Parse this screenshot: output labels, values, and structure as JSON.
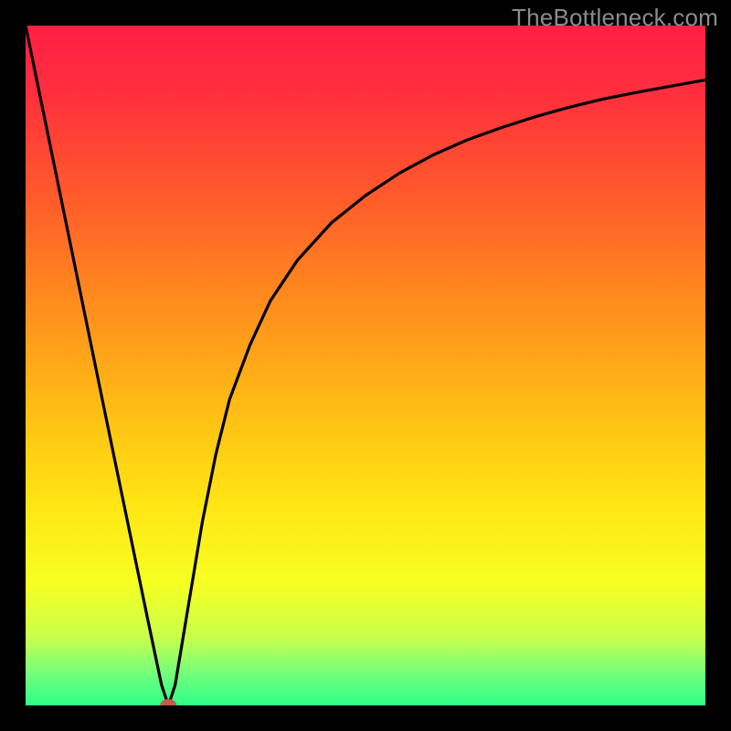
{
  "watermark": {
    "text": "TheBottleneck.com"
  },
  "gradient": {
    "stops": [
      {
        "offset": 0.0,
        "color": "#ff1f44"
      },
      {
        "offset": 0.1,
        "color": "#ff2f3d"
      },
      {
        "offset": 0.25,
        "color": "#ff5a2b"
      },
      {
        "offset": 0.4,
        "color": "#ff8a1e"
      },
      {
        "offset": 0.55,
        "color": "#ffb915"
      },
      {
        "offset": 0.7,
        "color": "#ffe413"
      },
      {
        "offset": 0.82,
        "color": "#f7ff22"
      },
      {
        "offset": 0.9,
        "color": "#c8ff4a"
      },
      {
        "offset": 0.95,
        "color": "#77ff7a"
      },
      {
        "offset": 1.0,
        "color": "#2fff88"
      }
    ]
  },
  "marker": {
    "color": "#c65a4a",
    "rx": 9,
    "ry": 7
  },
  "chart_data": {
    "type": "line",
    "title": "",
    "xlabel": "",
    "ylabel": "",
    "xlim": [
      0,
      100
    ],
    "ylim": [
      0,
      100
    ],
    "x": [
      0,
      4,
      8,
      12,
      15,
      18,
      20,
      21,
      22,
      24,
      26,
      28,
      30,
      33,
      36,
      40,
      45,
      50,
      55,
      60,
      65,
      70,
      75,
      80,
      85,
      90,
      95,
      100
    ],
    "values": [
      100,
      80.5,
      61,
      41.5,
      27,
      12.5,
      3,
      0,
      3,
      15,
      27,
      37,
      45,
      53,
      59.5,
      65.5,
      71,
      75,
      78.3,
      81,
      83.2,
      85,
      86.6,
      88,
      89.2,
      90.2,
      91.1,
      92
    ],
    "marker_point": {
      "x": 21,
      "y": 0
    },
    "notes": "Values are bottleneck percentage (y) vs. component score (x), read from the curve shape; minimum bottleneck at x≈21."
  }
}
